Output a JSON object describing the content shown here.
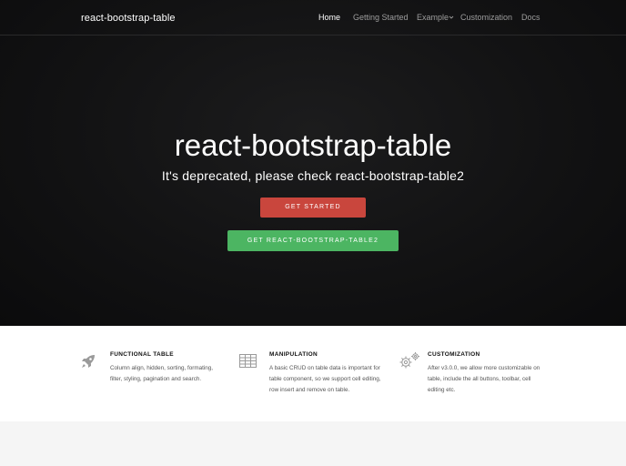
{
  "navbar": {
    "brand": "react-bootstrap-table",
    "items": [
      {
        "label": "Home"
      },
      {
        "label": "Getting Started"
      },
      {
        "label": "Example"
      },
      {
        "label": "Customization"
      },
      {
        "label": "Docs"
      }
    ],
    "active_item": "Home"
  },
  "hero": {
    "title": "react-bootstrap-table",
    "subtitle": "It's deprecated, please check react-bootstrap-table2",
    "primary_button": "GET STARTED",
    "secondary_button": "GET REACT-BOOTSTRAP-TABLE2"
  },
  "features": [
    {
      "icon": "rocket-icon",
      "title": "FUNCTIONAL TABLE",
      "description": "Column align, hidden, sorting, formating, filter, styling, pagination and search."
    },
    {
      "icon": "table-grid-icon",
      "title": "MANIPULATION",
      "description": "A basic CRUD on table data is important for table component, so we support cell editing, row insert and remove on table."
    },
    {
      "icon": "gears-icon",
      "title": "CUSTOMIZATION",
      "description": "After v3.0.0, we allow more customizable on table, include the all buttons, toolbar, cell editing etc."
    }
  ],
  "colors": {
    "hero_bg": "#121213",
    "get_started": "#c9463d",
    "table2_button": "#4cb562",
    "nav_text": "#9d9d9d",
    "active_nav": "#ffffff"
  }
}
